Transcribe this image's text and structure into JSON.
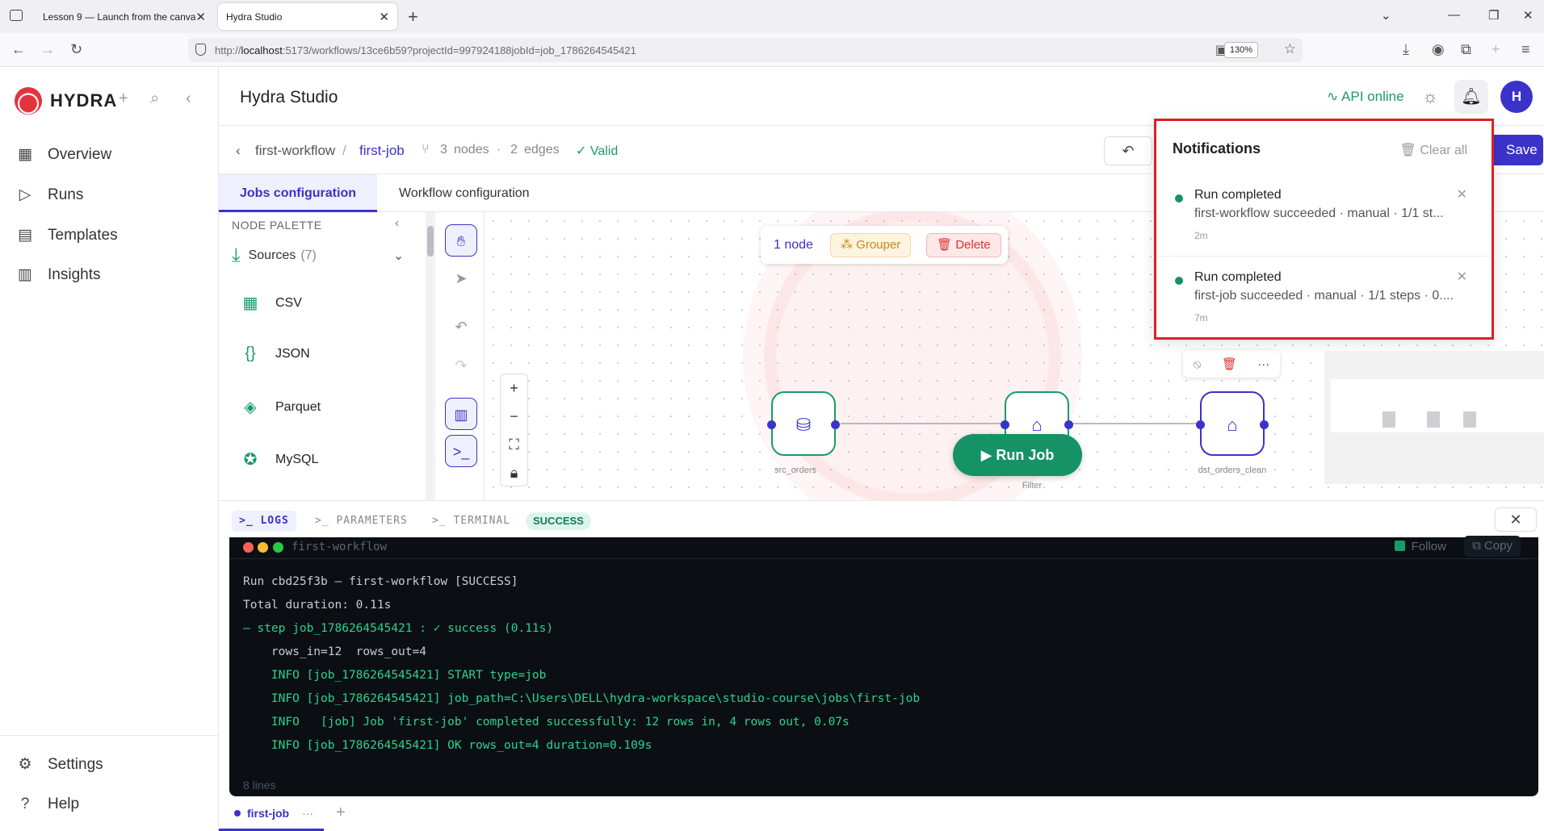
{
  "browser": {
    "tabs": [
      {
        "title": "Lesson 9 — Launch from the canva"
      },
      {
        "title": "Hydra Studio"
      }
    ],
    "url_prefix": "http://",
    "url_host": "localhost",
    "url_rest": ":5173/workflows/13ce6b59?projectId=997924188jobId=job_1786264545421",
    "zoom": "130%"
  },
  "sidebar": {
    "brand": "HYDRA",
    "items": [
      {
        "label": "Overview",
        "icon": "grid-icon"
      },
      {
        "label": "Runs",
        "icon": "play-icon"
      },
      {
        "label": "Templates",
        "icon": "layout-icon"
      },
      {
        "label": "Insights",
        "icon": "bar-chart-icon"
      }
    ],
    "footer": [
      {
        "label": "Settings",
        "icon": "gear-icon"
      },
      {
        "label": "Help",
        "icon": "help-icon"
      }
    ]
  },
  "topbar": {
    "title": "Hydra Studio",
    "api_status": "API online",
    "avatar_initial": "H"
  },
  "breadcrumb": {
    "parent": "first-workflow",
    "current": "first-job",
    "nodes_count": "3",
    "nodes_label": "nodes",
    "edges_count": "2",
    "edges_label": "edges",
    "validity": "Valid",
    "save_label": "Save"
  },
  "config_tabs": [
    {
      "label": "Jobs configuration",
      "active": true
    },
    {
      "label": "Workflow configuration",
      "active": false
    }
  ],
  "palette": {
    "header": "NODE PALETTE",
    "section_label": "Sources",
    "section_count": "(7)",
    "items": [
      "CSV",
      "JSON",
      "Parquet",
      "MySQL"
    ]
  },
  "selection_bar": {
    "count": "1 node",
    "grouper": "Grouper",
    "delete": "Delete"
  },
  "nodes": [
    {
      "label": "src_orders"
    },
    {
      "label": "Filter"
    },
    {
      "label": "dst_orders_clean"
    }
  ],
  "run_button": "Run Job",
  "log_tabs": [
    "LOGS",
    "PARAMETERS",
    "TERMINAL"
  ],
  "run_status": "SUCCESS",
  "terminal": {
    "title": "first-workflow",
    "follow": "Follow",
    "copy": "Copy",
    "lines": [
      "Run cbd25f3b — first-workflow [SUCCESS]",
      "Total duration: 0.11s",
      "— step job_1786264545421 : ✓ success (0.11s)",
      "    rows_in=12  rows_out=4",
      "    INFO [job_1786264545421] START type=job",
      "    INFO [job_1786264545421] job_path=C:\\Users\\DELL\\hydra-workspace\\studio-course\\jobs\\first-job",
      "    INFO   [job] Job 'first-job' completed successfully: 12 rows in, 4 rows out, 0.07s",
      "    INFO [job_1786264545421] OK rows_out=4 duration=0.109s"
    ],
    "footer": "8 lines"
  },
  "file_tab": "first-job",
  "notifications": {
    "title": "Notifications",
    "clear_all": "Clear all",
    "items": [
      {
        "title": "Run completed",
        "subtitle": "first-workflow succeeded · manual · 1/1 st...",
        "time": "2m"
      },
      {
        "title": "Run completed",
        "subtitle": "first-job succeeded · manual · 1/1 steps · 0....",
        "time": "7m"
      }
    ]
  },
  "colors": {
    "accent": "#3b33c9",
    "success": "#159266",
    "brand_red": "#e2343d",
    "highlight_border": "#dc1f26"
  }
}
